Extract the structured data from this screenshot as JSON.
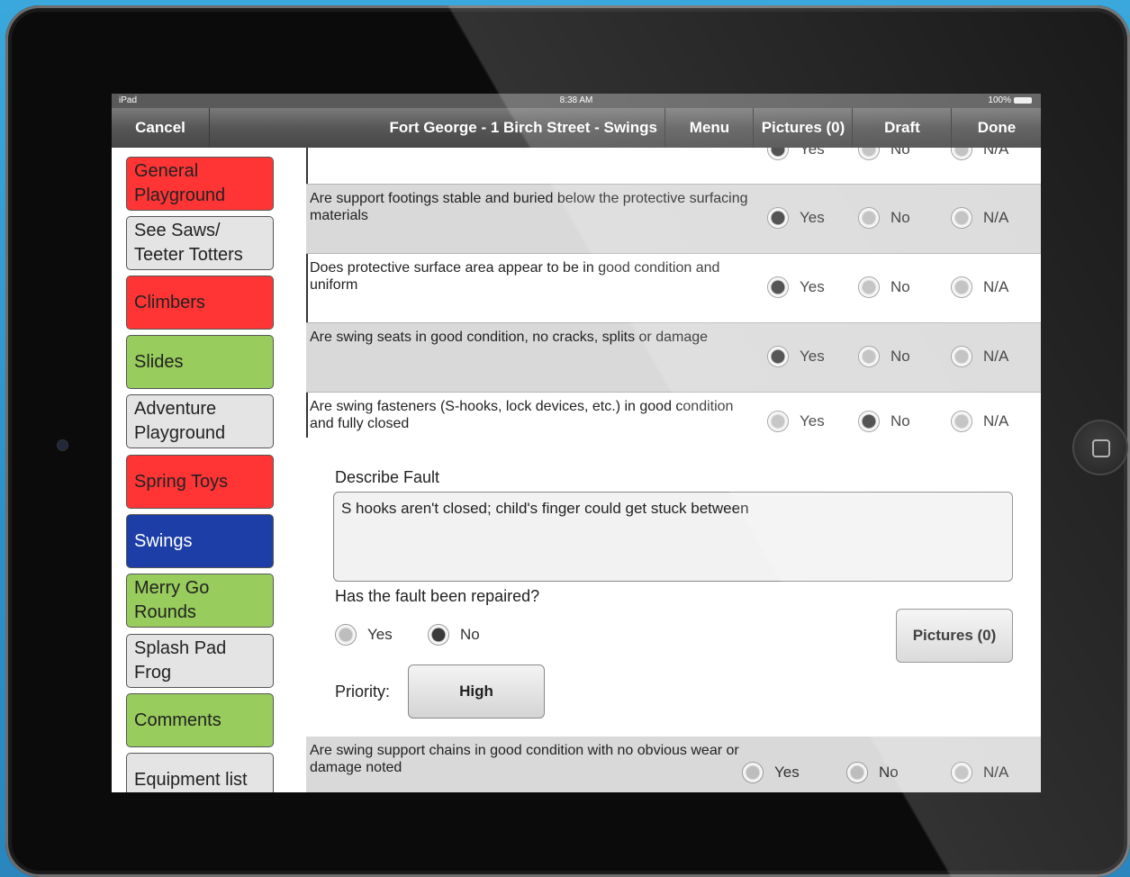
{
  "status": {
    "carrier": "iPad",
    "time": "8:38 AM",
    "battery": "100%"
  },
  "nav": {
    "cancel": "Cancel",
    "title": "Fort George - 1 Birch Street - Swings",
    "menu": "Menu",
    "pictures": "Pictures (0)",
    "draft": "Draft",
    "done": "Done"
  },
  "sidebar": {
    "items": [
      {
        "label": "General Playground",
        "color": "#ff3535"
      },
      {
        "label": "See Saws/ Teeter Totters",
        "color": "#e4e4e4"
      },
      {
        "label": "Climbers",
        "color": "#ff3535"
      },
      {
        "label": "Slides",
        "color": "#98cc5c"
      },
      {
        "label": "Adventure Playground",
        "color": "#e4e4e4"
      },
      {
        "label": "Spring Toys",
        "color": "#ff3535"
      },
      {
        "label": "Swings",
        "color": "#1d3ea6"
      },
      {
        "label": "Merry Go Rounds",
        "color": "#98cc5c"
      },
      {
        "label": "Splash Pad Frog",
        "color": "#e4e4e4"
      },
      {
        "label": "Comments",
        "color": "#98cc5c"
      },
      {
        "label": "Equipment list",
        "color": "#e4e4e4"
      }
    ]
  },
  "options": {
    "yes": "Yes",
    "no": "No",
    "na": "N/A"
  },
  "questions": [
    {
      "text": "",
      "answer": "yes"
    },
    {
      "text": "Are support footings stable and buried below the protective surfacing materials",
      "answer": "yes"
    },
    {
      "text": "Does protective surface area appear to be in good condition and uniform",
      "answer": "yes"
    },
    {
      "text": "Are swing seats in good condition, no cracks, splits or damage",
      "answer": "yes"
    },
    {
      "text": "Are swing fasteners (S-hooks, lock devices, etc.) in good condition and fully closed",
      "answer": "no"
    },
    {
      "text": "Are swing support chains in good condition with no obvious wear or damage noted",
      "answer": ""
    }
  ],
  "fault": {
    "describe_label": "Describe Fault",
    "description": "S hooks aren't closed; child's finger could get stuck between",
    "repaired_label": "Has the fault been repaired?",
    "repaired_yes": "Yes",
    "repaired_no": "No",
    "repaired": "no",
    "pictures_button": "Pictures (0)",
    "priority_label": "Priority:",
    "priority_value": "High"
  }
}
